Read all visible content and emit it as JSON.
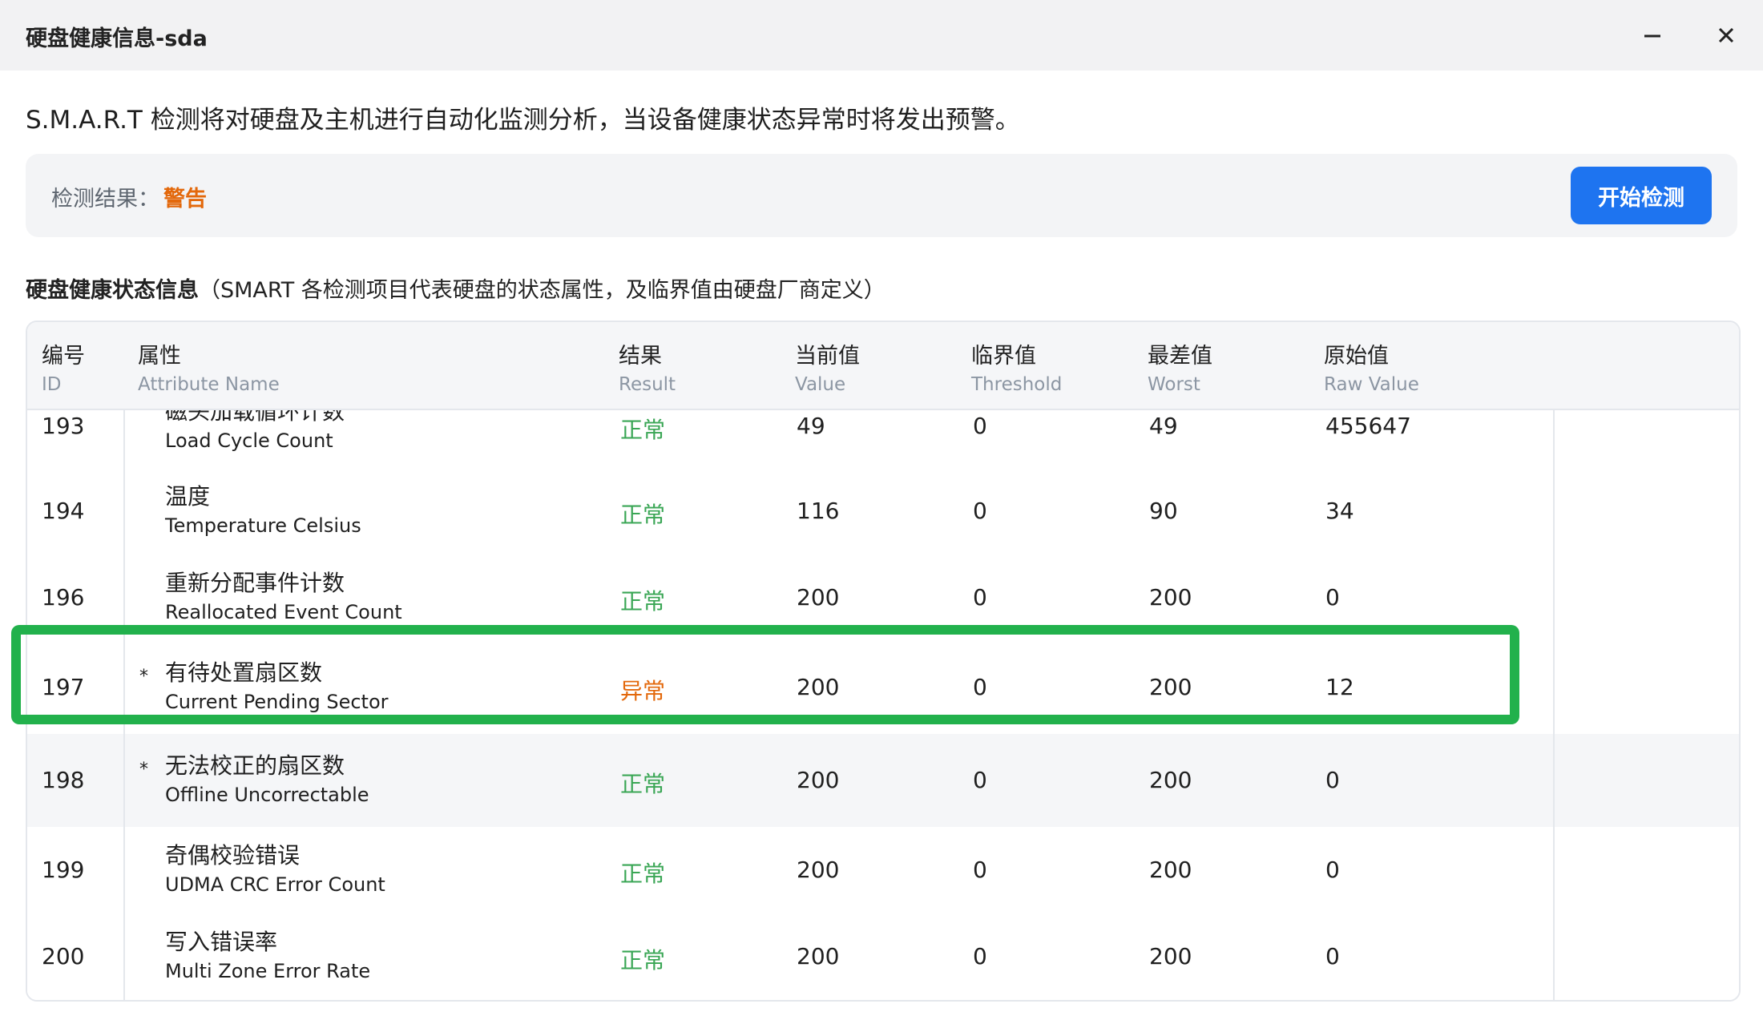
{
  "window": {
    "title": "硬盘健康信息-sda",
    "min_icon": "minimize-icon",
    "close_icon": "close-icon"
  },
  "description": "S.M.A.R.T 检测将对硬盘及主机进行自动化监测分析，当设备健康状态异常时将发出预警。",
  "result": {
    "label": "检测结果：",
    "value": "警告",
    "button": "开始检测"
  },
  "section": {
    "title_bold": "硬盘健康状态信息",
    "title_note": "（SMART 各检测项目代表硬盘的状态属性，及临界值由硬盘厂商定义）"
  },
  "table": {
    "headers": [
      {
        "zh": "编号",
        "en": "ID"
      },
      {
        "zh": "属性",
        "en": "Attribute Name"
      },
      {
        "zh": "结果",
        "en": "Result"
      },
      {
        "zh": "当前值",
        "en": "Value"
      },
      {
        "zh": "临界值",
        "en": "Threshold"
      },
      {
        "zh": "最差值",
        "en": "Worst"
      },
      {
        "zh": "原始值",
        "en": "Raw Value"
      }
    ],
    "rows": [
      {
        "id": "193",
        "star": "",
        "zh": "磁头加载循环计数",
        "en": "Load Cycle Count",
        "result": "正常",
        "status": "ok",
        "value": "49",
        "threshold": "0",
        "worst": "49",
        "raw": "455647"
      },
      {
        "id": "194",
        "star": "",
        "zh": "温度",
        "en": "Temperature Celsius",
        "result": "正常",
        "status": "ok",
        "value": "116",
        "threshold": "0",
        "worst": "90",
        "raw": "34"
      },
      {
        "id": "196",
        "star": "",
        "zh": "重新分配事件计数",
        "en": "Reallocated Event Count",
        "result": "正常",
        "status": "ok",
        "value": "200",
        "threshold": "0",
        "worst": "200",
        "raw": "0"
      },
      {
        "id": "197",
        "star": "*",
        "zh": "有待处置扇区数",
        "en": "Current Pending Sector",
        "result": "异常",
        "status": "bad",
        "value": "200",
        "threshold": "0",
        "worst": "200",
        "raw": "12"
      },
      {
        "id": "198",
        "star": "*",
        "zh": "无法校正的扇区数",
        "en": "Offline Uncorrectable",
        "result": "正常",
        "status": "ok",
        "value": "200",
        "threshold": "0",
        "worst": "200",
        "raw": "0"
      },
      {
        "id": "199",
        "star": "",
        "zh": "奇偶校验错误",
        "en": "UDMA CRC Error Count",
        "result": "正常",
        "status": "ok",
        "value": "200",
        "threshold": "0",
        "worst": "200",
        "raw": "0"
      },
      {
        "id": "200",
        "star": "",
        "zh": "写入错误率",
        "en": "Multi Zone Error Rate",
        "result": "正常",
        "status": "ok",
        "value": "200",
        "threshold": "0",
        "worst": "200",
        "raw": "0"
      }
    ]
  },
  "colors": {
    "ok": "#3aa655",
    "bad": "#e3680b",
    "accent": "#1e74f0",
    "highlight": "#22b14c"
  }
}
